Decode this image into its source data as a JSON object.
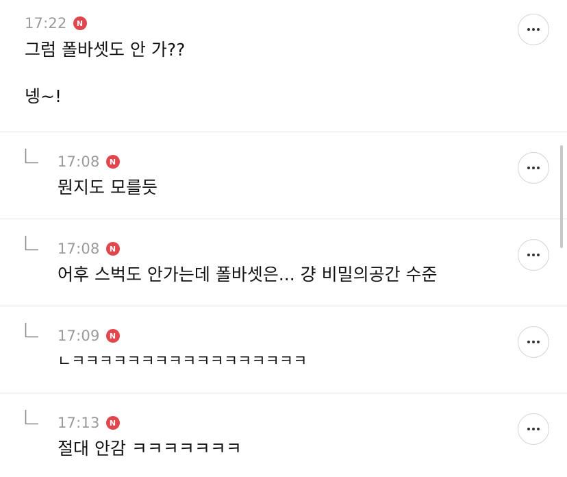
{
  "comments": [
    {
      "time": "17:22",
      "badge": "N",
      "text": "그럼 폴바셋도 안 가??\n\n넹~!"
    },
    {
      "time": "17:08",
      "badge": "N",
      "text": "뭔지도 모를듯"
    },
    {
      "time": "17:08",
      "badge": "N",
      "text": "어후 스벅도 안가는데 폴바셋은... 걍 비밀의공간 수준"
    },
    {
      "time": "17:09",
      "badge": "N",
      "text": "ㄴㅋㅋㅋㅋㅋㅋㅋㅋㅋㅋㅋㅋㅋㅋㅋㅋㅋ"
    },
    {
      "time": "17:13",
      "badge": "N",
      "text": "절대 안감 ㅋㅋㅋㅋㅋㅋㅋ"
    }
  ],
  "icons": {
    "more": "more-horizontal-icon",
    "reply": "reply-arrow-icon",
    "new_badge_color": "#e0464b"
  }
}
